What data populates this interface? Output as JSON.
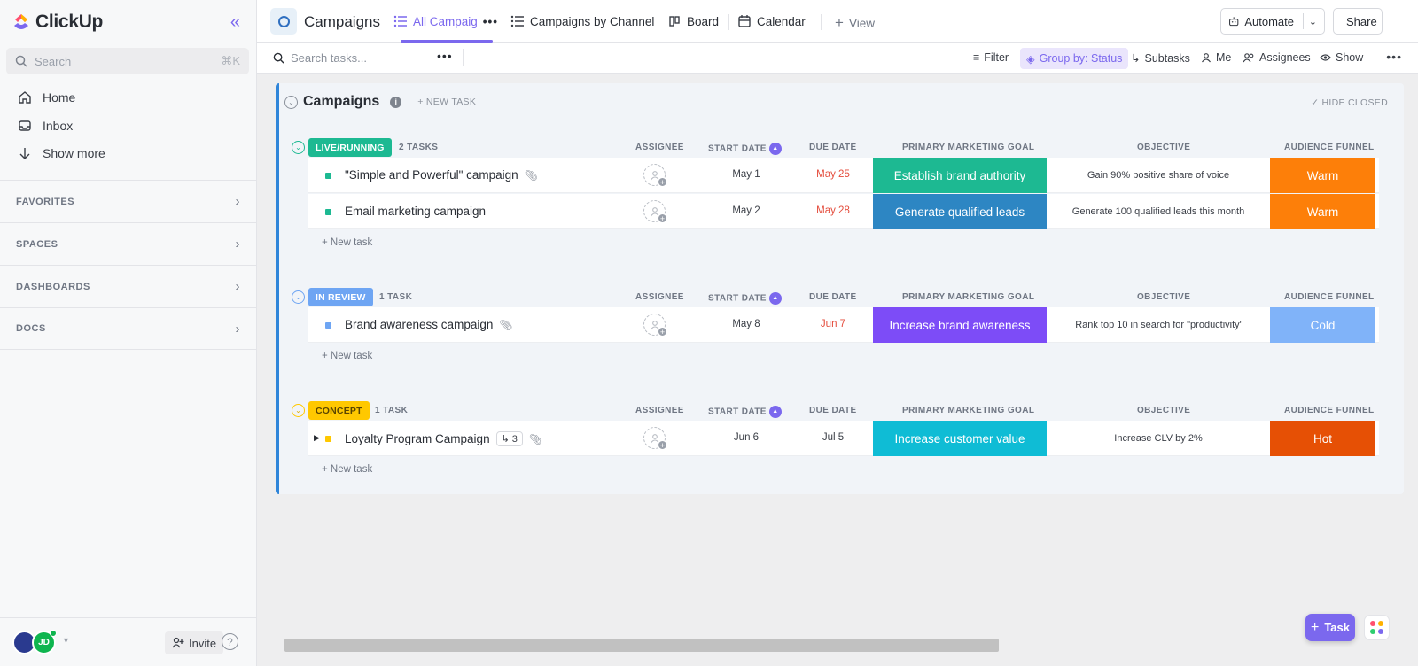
{
  "app": {
    "name": "ClickUp"
  },
  "sidebar": {
    "search_placeholder": "Search",
    "search_shortcut": "⌘K",
    "nav": [
      {
        "label": "Home",
        "icon": "home-icon"
      },
      {
        "label": "Inbox",
        "icon": "inbox-icon"
      },
      {
        "label": "Show more",
        "icon": "arrow-down-icon"
      }
    ],
    "sections": [
      "FAVORITES",
      "SPACES",
      "DASHBOARDS",
      "DOCS"
    ],
    "user_initials": "JD",
    "invite_label": "Invite"
  },
  "topbar": {
    "title": "Campaigns",
    "views": [
      "All Campaig",
      "Campaigns by Channel",
      "Board",
      "Calendar"
    ],
    "add_view": "View",
    "automate": "Automate",
    "share": "Share"
  },
  "toolbar": {
    "search_placeholder": "Search tasks...",
    "filter": "Filter",
    "group_by": "Group by: Status",
    "subtasks": "Subtasks",
    "me": "Me",
    "assignees": "Assignees",
    "show": "Show"
  },
  "list": {
    "title": "Campaigns",
    "new_task": "+ NEW TASK",
    "hide_closed": "HIDE CLOSED",
    "columns": {
      "assignee": "ASSIGNEE",
      "start_date": "START DATE",
      "due_date": "DUE DATE",
      "goal": "PRIMARY MARKETING GOAL",
      "objective": "OBJECTIVE",
      "funnel": "AUDIENCE FUNNEL"
    },
    "add_task": "+ New task",
    "groups": [
      {
        "status": "LIVE/RUNNING",
        "count": "2 TASKS",
        "color": "#1db992",
        "tasks": [
          {
            "name": "\"Simple and Powerful\" campaign",
            "start": "May 1",
            "due": "May 25",
            "goal": "Establish brand authority",
            "goal_color": "#1db992",
            "objective": "Gain 90% positive share of voice",
            "funnel": "Warm",
            "funnel_color": "#fd7f09"
          },
          {
            "name": "Email marketing campaign",
            "start": "May 2",
            "due": "May 28",
            "goal": "Generate qualified leads",
            "goal_color": "#2d86c3",
            "objective": "Generate 100 qualified leads this month",
            "funnel": "Warm",
            "funnel_color": "#fd7f09"
          }
        ]
      },
      {
        "status": "IN REVIEW",
        "count": "1 TASK",
        "color": "#6ea5f3",
        "tasks": [
          {
            "name": "Brand awareness campaign",
            "start": "May 8",
            "due": "Jun 7",
            "goal": "Increase brand awareness",
            "goal_color": "#7d4cf7",
            "objective": "Rank top 10 in search for \"productivity'",
            "funnel": "Cold",
            "funnel_color": "#80b3f9"
          }
        ]
      },
      {
        "status": "CONCEPT",
        "count": "1 TASK",
        "color": "#ffc800",
        "tasks": [
          {
            "name": "Loyalty Program Campaign",
            "subtasks": "3",
            "start": "Jun 6",
            "due": "Jul 5",
            "goal": "Increase customer value",
            "goal_color": "#0fbcd5",
            "objective": "Increase CLV by 2%",
            "funnel": "Hot",
            "funnel_color": "#e65005"
          }
        ]
      }
    ]
  },
  "fab": {
    "task_label": "Task"
  }
}
